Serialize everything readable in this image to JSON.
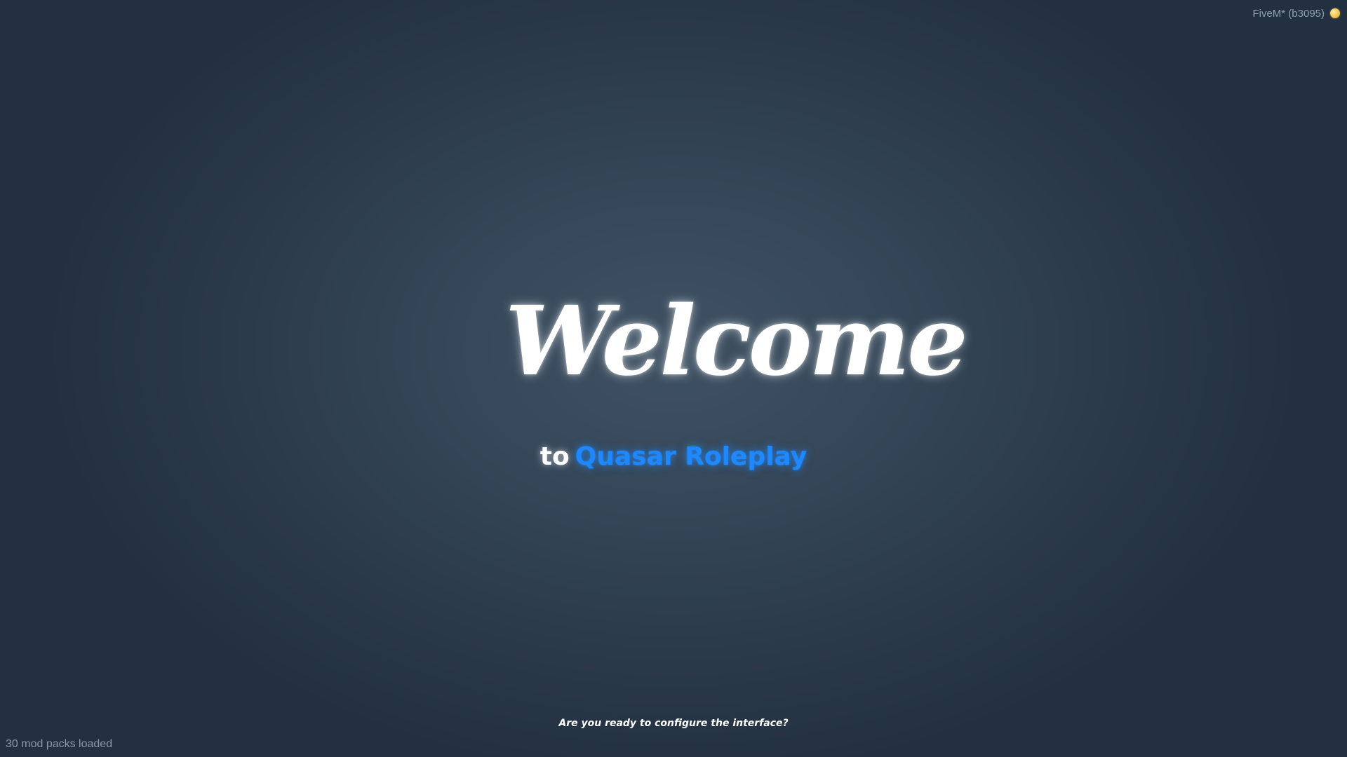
{
  "status_bar": {
    "build_label": "FiveM* (b3095)",
    "status_icon": "status-dot-icon",
    "status_color": "#f1c84e"
  },
  "welcome": {
    "title": "Welcome",
    "subtitle_prefix": "to",
    "subtitle_brand": "Quasar Roleplay",
    "brand_color": "#1f88ff",
    "prompt": "Are you ready to configure the interface?"
  },
  "footer": {
    "mod_packs_status": "30 mod packs loaded"
  }
}
